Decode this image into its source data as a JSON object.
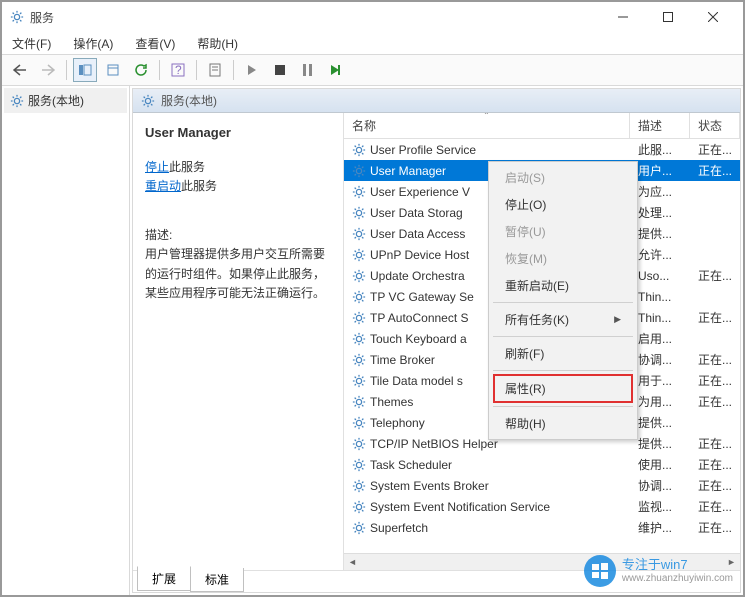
{
  "window": {
    "title": "服务"
  },
  "menubar": {
    "file": "文件(F)",
    "action": "操作(A)",
    "view": "查看(V)",
    "help": "帮助(H)"
  },
  "tree": {
    "root": "服务(本地)"
  },
  "panel_header": "服务(本地)",
  "detail": {
    "service_name": "User Manager",
    "stop_link": "停止",
    "stop_suffix": "此服务",
    "restart_link": "重启动",
    "restart_suffix": "此服务",
    "desc_label": "描述:",
    "description": "用户管理器提供多用户交互所需要的运行时组件。如果停止此服务，某些应用程序可能无法正确运行。"
  },
  "columns": {
    "name": "名称",
    "desc": "描述",
    "status": "状态"
  },
  "services": [
    {
      "name": "User Profile Service",
      "desc": "此服...",
      "status": "正在..."
    },
    {
      "name": "User Manager",
      "desc": "用户...",
      "status": "正在...",
      "selected": true
    },
    {
      "name": "User Experience V",
      "desc": "为应...",
      "status": ""
    },
    {
      "name": "User Data Storag",
      "desc": "处理...",
      "status": ""
    },
    {
      "name": "User Data Access",
      "desc": "提供...",
      "status": ""
    },
    {
      "name": "UPnP Device Host",
      "desc": "允许...",
      "status": ""
    },
    {
      "name": "Update Orchestra",
      "desc": "Uso...",
      "status": "正在..."
    },
    {
      "name": "TP VC Gateway Se",
      "desc": "Thin...",
      "status": ""
    },
    {
      "name": "TP AutoConnect S",
      "desc": "Thin...",
      "status": "正在..."
    },
    {
      "name": "Touch Keyboard a",
      "desc": "启用...",
      "status": ""
    },
    {
      "name": "Time Broker",
      "desc": "协调...",
      "status": "正在..."
    },
    {
      "name": "Tile Data model s",
      "desc": "用于...",
      "status": "正在..."
    },
    {
      "name": "Themes",
      "desc": "为用...",
      "status": "正在..."
    },
    {
      "name": "Telephony",
      "desc": "提供...",
      "status": ""
    },
    {
      "name": "TCP/IP NetBIOS Helper",
      "desc": "提供...",
      "status": "正在..."
    },
    {
      "name": "Task Scheduler",
      "desc": "使用...",
      "status": "正在..."
    },
    {
      "name": "System Events Broker",
      "desc": "协调...",
      "status": "正在..."
    },
    {
      "name": "System Event Notification Service",
      "desc": "监视...",
      "status": "正在..."
    },
    {
      "name": "Superfetch",
      "desc": "维护...",
      "status": "正在..."
    }
  ],
  "context_menu": {
    "start": "启动(S)",
    "stop": "停止(O)",
    "pause": "暂停(U)",
    "resume": "恢复(M)",
    "restart": "重新启动(E)",
    "all_tasks": "所有任务(K)",
    "refresh": "刷新(F)",
    "properties": "属性(R)",
    "help": "帮助(H)"
  },
  "tabs": {
    "extended": "扩展",
    "standard": "标准"
  },
  "watermark": {
    "text": "专注于win7",
    "url": "www.zhuanzhuyiwin.com"
  }
}
